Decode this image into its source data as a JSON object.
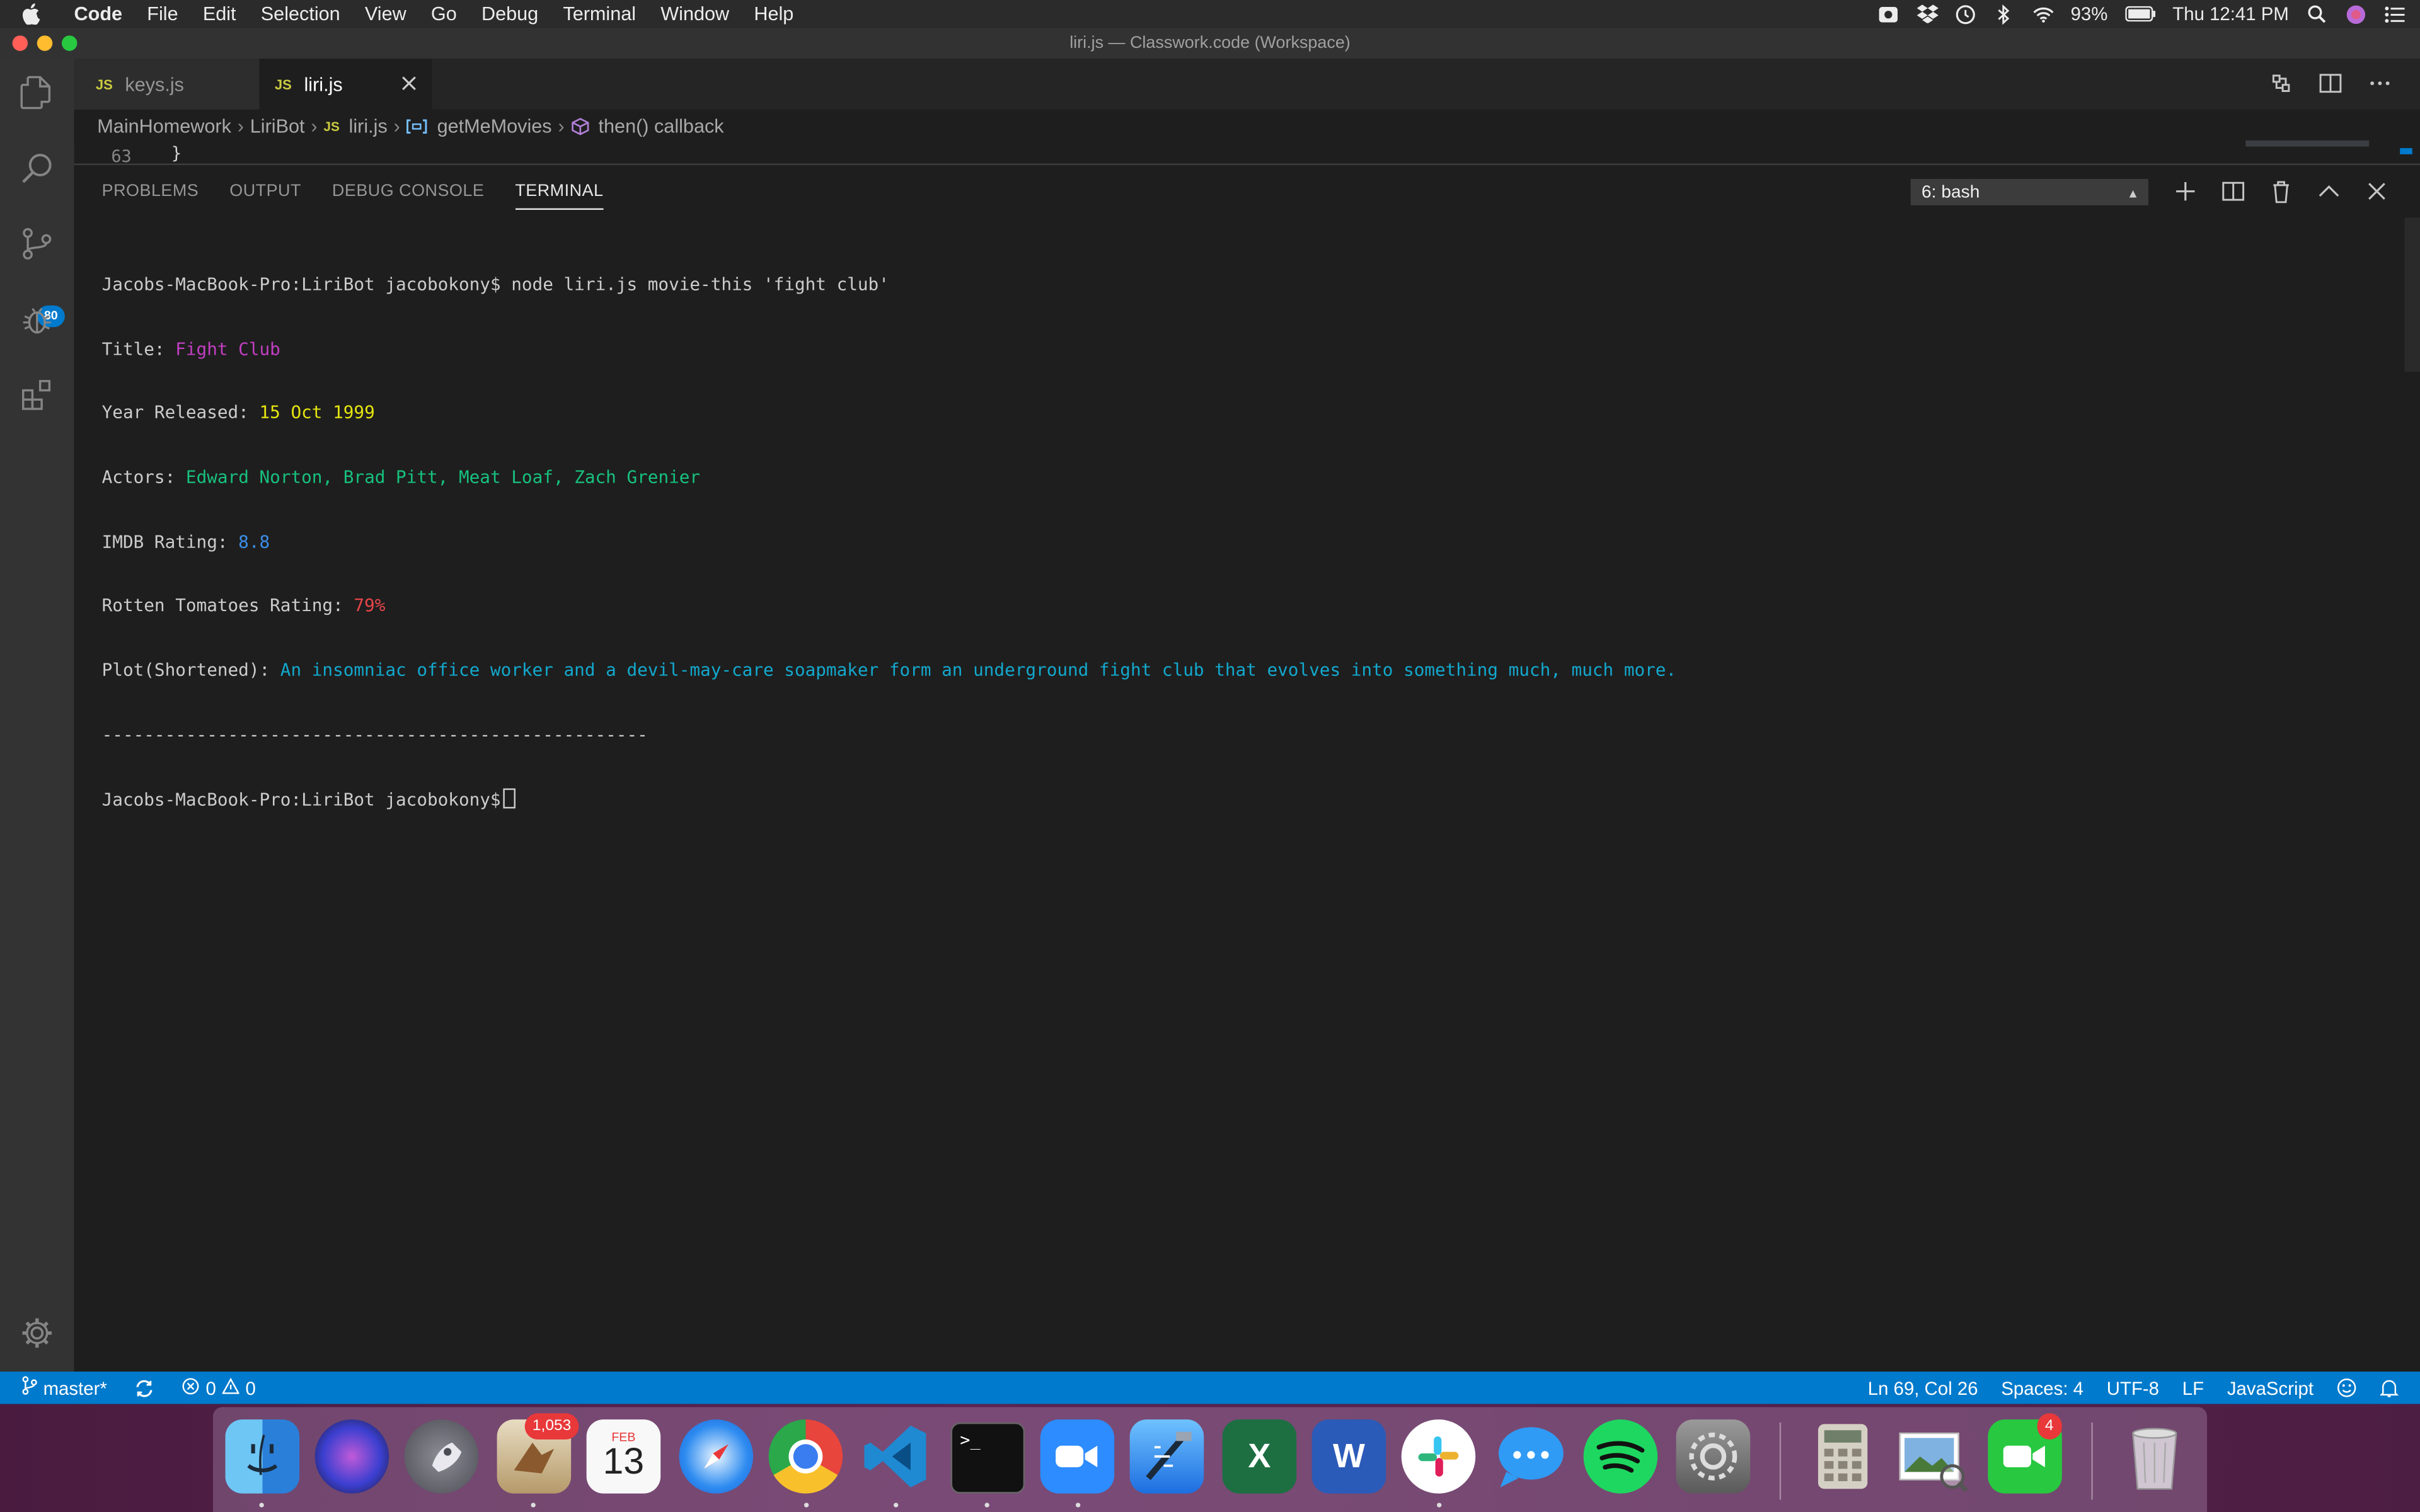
{
  "menubar": {
    "app_name": "Code",
    "menus": [
      "File",
      "Edit",
      "Selection",
      "View",
      "Go",
      "Debug",
      "Terminal",
      "Window",
      "Help"
    ],
    "battery": "93%",
    "clock": "Thu 12:41 PM"
  },
  "window": {
    "title": "liri.js — Classwork.code (Workspace)"
  },
  "activity_bar": {
    "scm_badge": "80"
  },
  "tabs": [
    {
      "label": "keys.js",
      "lang_badge": "JS"
    },
    {
      "label": "liri.js",
      "lang_badge": "JS"
    }
  ],
  "breadcrumb": {
    "items": [
      "MainHomework",
      "LiriBot",
      "liri.js",
      "getMeMovies",
      "then() callback"
    ],
    "js_badge": "JS"
  },
  "editor_peek": {
    "line_number": "63",
    "code": "}"
  },
  "panel": {
    "tabs": [
      "PROBLEMS",
      "OUTPUT",
      "DEBUG CONSOLE",
      "TERMINAL"
    ],
    "active_tab": "TERMINAL",
    "shell_select": "6: bash"
  },
  "terminal": {
    "prompt": "Jacobs-MacBook-Pro:LiriBot jacobokony$",
    "command": " node liri.js movie-this 'fight club'",
    "lines": [
      {
        "label": "Title: ",
        "value": "Fight Club"
      },
      {
        "label": "Year Released: ",
        "value": "15 Oct 1999"
      },
      {
        "label": "Actors: ",
        "value": "Edward Norton, Brad Pitt, Meat Loaf, Zach Grenier"
      },
      {
        "label": "IMDB Rating: ",
        "value": "8.8"
      },
      {
        "label": "Rotten Tomatoes Rating: ",
        "value": "79%"
      },
      {
        "label": "Plot(Shortened): ",
        "value": "An insomniac office worker and a devil-may-care soapmaker form an underground fight club that evolves into something much, much more."
      }
    ],
    "divider": "----------------------------------------------------",
    "final_prompt": "Jacobs-MacBook-Pro:LiriBot jacobokony$"
  },
  "statusbar": {
    "branch": "master*",
    "errors": "0",
    "warnings": "0",
    "cursor_position": "Ln 69, Col 26",
    "indentation": "Spaces: 4",
    "encoding": "UTF-8",
    "eol": "LF",
    "language": "JavaScript"
  },
  "dock": {
    "mail_badge": "1,053",
    "calendar_month": "FEB",
    "calendar_day": "13",
    "facetime_badge": "4",
    "excel_letter": "X",
    "word_letter": "W"
  },
  "colors": {
    "accent": "#007acc",
    "title_value": "#c23fc3",
    "year_value": "#e5e510",
    "actors_value": "#17c17e",
    "imdb_value": "#3b8eea",
    "rt_value": "#e8454a",
    "plot_value": "#13a8cd"
  }
}
